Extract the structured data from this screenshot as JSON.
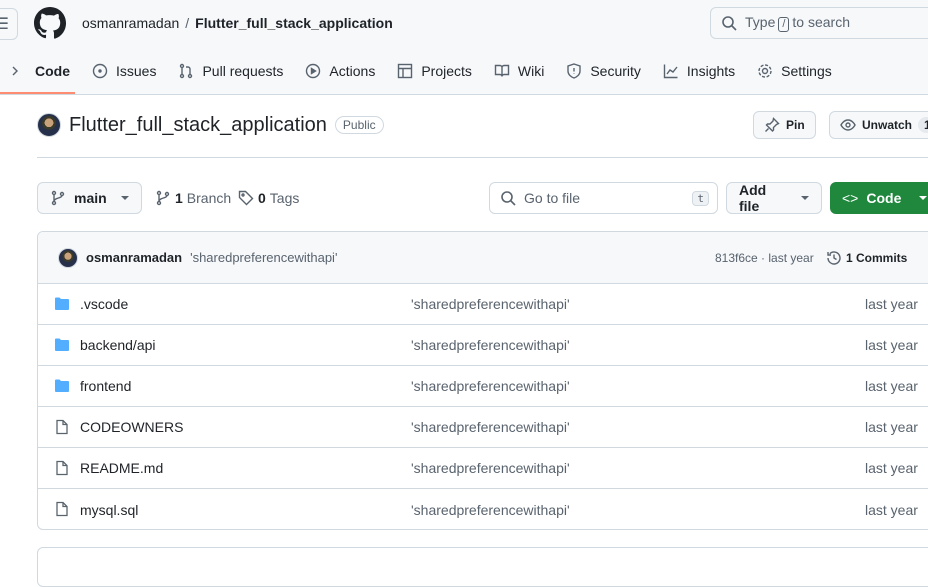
{
  "header": {
    "owner": "osmanramadan",
    "separator": "/",
    "repo": "Flutter_full_stack_application",
    "search_prefix": "Type",
    "search_key": "/",
    "search_suffix": "to search"
  },
  "tabs": [
    {
      "label": "Code",
      "icon": "chevron-icon"
    },
    {
      "label": "Issues",
      "icon": "issue-icon"
    },
    {
      "label": "Pull requests",
      "icon": "pull-request-icon"
    },
    {
      "label": "Actions",
      "icon": "play-icon"
    },
    {
      "label": "Projects",
      "icon": "table-icon"
    },
    {
      "label": "Wiki",
      "icon": "book-icon"
    },
    {
      "label": "Security",
      "icon": "shield-icon"
    },
    {
      "label": "Insights",
      "icon": "graph-icon"
    },
    {
      "label": "Settings",
      "icon": "gear-icon"
    }
  ],
  "repo": {
    "title": "Flutter_full_stack_application",
    "visibility": "Public",
    "pin": "Pin",
    "unwatch": "Unwatch",
    "watch_count": "1"
  },
  "toolbar": {
    "branch": "main",
    "branches": "1",
    "branches_label": "Branch",
    "tags": "0",
    "tags_label": "Tags",
    "goto_placeholder": "Go to file",
    "goto_key": "t",
    "add_file": "Add file",
    "code": "Code"
  },
  "commit": {
    "author": "osmanramadan",
    "message": "'sharedpreferencewithapi'",
    "sha_time": "813f6ce · last year",
    "commits": "1 Commits"
  },
  "files": [
    {
      "name": ".vscode",
      "type": "folder",
      "message": "'sharedpreferencewithapi'",
      "age": "last year"
    },
    {
      "name": "backend/api",
      "type": "folder",
      "message": "'sharedpreferencewithapi'",
      "age": "last year"
    },
    {
      "name": "frontend",
      "type": "folder",
      "message": "'sharedpreferencewithapi'",
      "age": "last year"
    },
    {
      "name": "CODEOWNERS",
      "type": "file",
      "message": "'sharedpreferencewithapi'",
      "age": "last year"
    },
    {
      "name": "README.md",
      "type": "file",
      "message": "'sharedpreferencewithapi'",
      "age": "last year"
    },
    {
      "name": "mysql.sql",
      "type": "file",
      "message": "'sharedpreferencewithapi'",
      "age": "last year"
    }
  ],
  "colors": {
    "accent": "#fd8c73",
    "green": "#1f883d",
    "folder": "#54aeff"
  }
}
